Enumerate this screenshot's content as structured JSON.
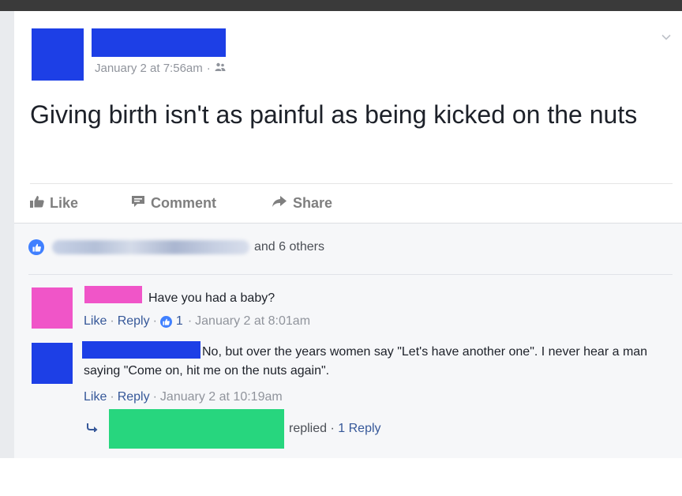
{
  "post": {
    "timestamp": "January 2 at 7:56am",
    "audience_icon": "friends-icon",
    "text": "Giving birth isn't as painful as being kicked on the nuts"
  },
  "actions": {
    "like_label": "Like",
    "comment_label": "Comment",
    "share_label": "Share"
  },
  "reactions": {
    "others_text": "and 6 others"
  },
  "comments": [
    {
      "text": "Have you had a baby?",
      "like_label": "Like",
      "reply_label": "Reply",
      "like_count": "1",
      "timestamp": "January 2 at 8:01am"
    },
    {
      "text": "No, but over the years women say \"Let's have another one\". I never hear a man saying \"Come on, hit me on the nuts again\".",
      "like_label": "Like",
      "reply_label": "Reply",
      "timestamp": "January 2 at 10:19am"
    }
  ],
  "reply_summary": {
    "replied_label": "replied",
    "reply_count_label": "1 Reply"
  },
  "colors": {
    "redact_blue": "#1d3fe6",
    "redact_pink": "#f055c8",
    "redact_green": "#27d67e",
    "link_blue": "#365899",
    "like_badge": "#4080ff"
  }
}
